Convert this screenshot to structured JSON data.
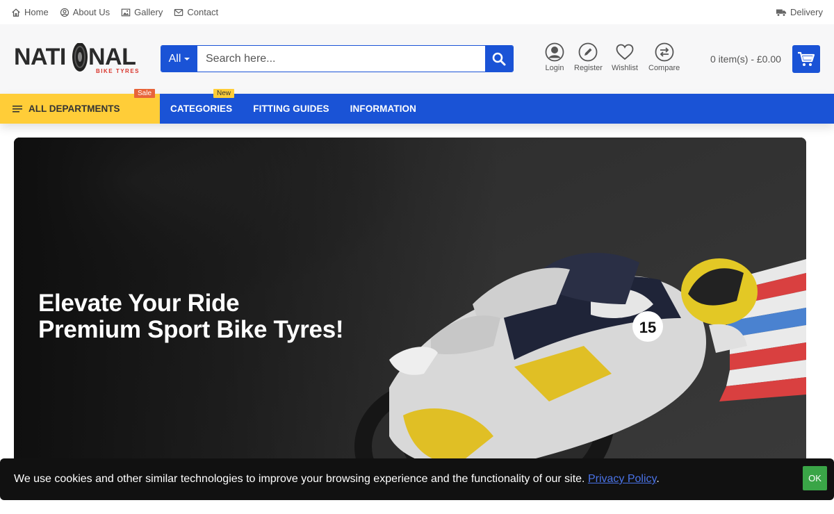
{
  "topbar": {
    "links": [
      "Home",
      "About Us",
      "Gallery",
      "Contact"
    ],
    "delivery": "Delivery"
  },
  "header": {
    "logo_main_left": "NATI",
    "logo_main_right": "NAL",
    "logo_sub": "BIKE TYRES",
    "search_category": "All",
    "search_placeholder": "Search here...",
    "account": [
      "Login",
      "Register",
      "Wishlist",
      "Compare"
    ],
    "cart_text": "0 item(s) - £0.00"
  },
  "nav": {
    "departments": "ALL DEPARTMENTS",
    "sale_badge": "Sale",
    "new_badge": "New",
    "items": [
      "CATEGORIES",
      "FITTING GUIDES",
      "INFORMATION"
    ]
  },
  "hero": {
    "line1": "Elevate Your Ride",
    "line2": "Premium Sport Bike Tyres!",
    "bike_number": "15"
  },
  "cookie": {
    "message": "We use cookies and other similar technologies to improve your browsing experience and the functionality of our site.",
    "link": "Privacy Policy",
    "suffix": ".",
    "ok": "OK"
  },
  "colors": {
    "primary": "#1a53d6",
    "accent": "#ffcd38",
    "sale": "#e8643a",
    "ok": "#3aa547",
    "logo_red": "#d9342b"
  }
}
